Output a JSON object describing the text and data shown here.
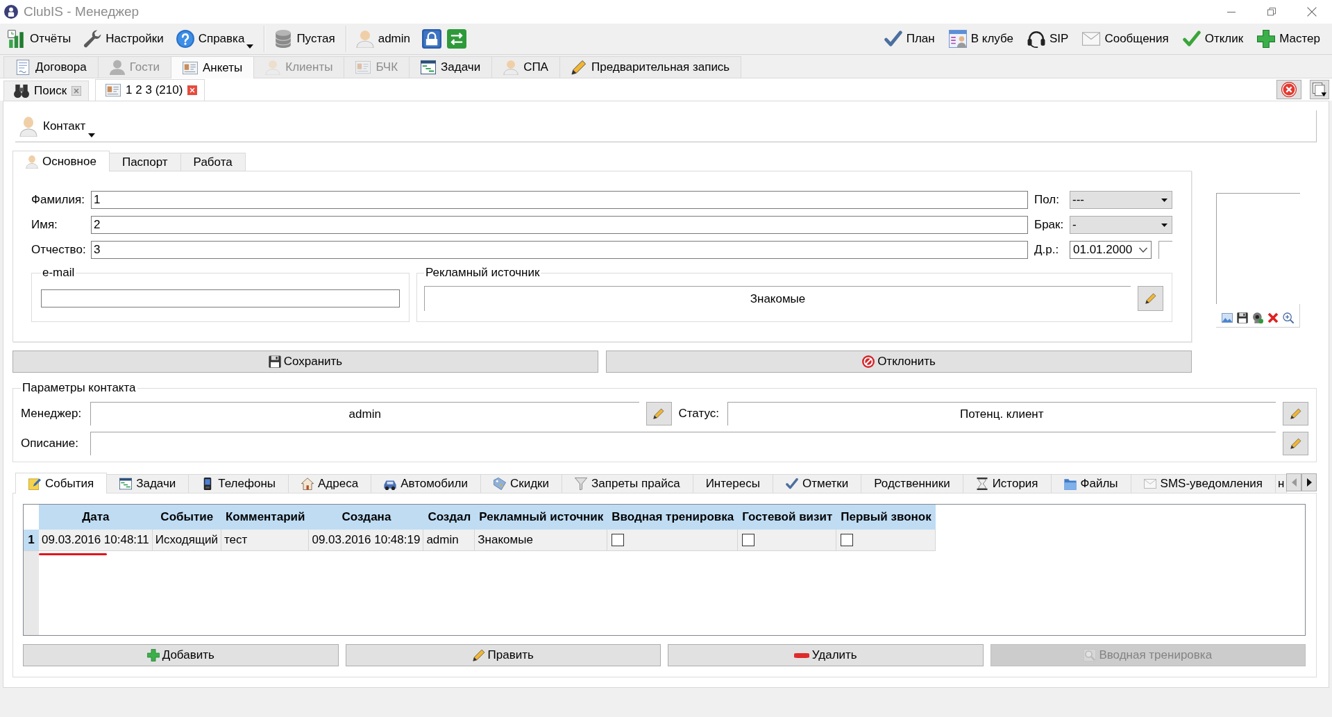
{
  "window": {
    "title": "ClubIS - Менеджер"
  },
  "toolbar": {
    "left_groups": [
      {
        "items": [
          {
            "label": "Отчёты",
            "dropdown": false
          },
          {
            "label": "Настройки",
            "dropdown": false
          },
          {
            "label": "Справка",
            "dropdown": true
          }
        ]
      },
      {
        "items": [
          {
            "label": "Пустая",
            "dropdown": false
          }
        ]
      },
      {
        "items": [
          {
            "label": "admin",
            "dropdown": false
          }
        ]
      }
    ],
    "right": [
      {
        "label": "План"
      },
      {
        "label": "В клубе"
      },
      {
        "label": "SIP"
      },
      {
        "label": "Сообщения"
      },
      {
        "label": "Отклик"
      },
      {
        "label": "Мастер"
      }
    ]
  },
  "module_tabs": [
    {
      "label": "Договора",
      "selected": false,
      "disabled": false
    },
    {
      "label": "Гости",
      "selected": false,
      "disabled": true
    },
    {
      "label": "Анкеты",
      "selected": true,
      "disabled": false
    },
    {
      "label": "Клиенты",
      "selected": false,
      "disabled": true
    },
    {
      "label": "БЧК",
      "selected": false,
      "disabled": true
    },
    {
      "label": "Задачи",
      "selected": false,
      "disabled": false
    },
    {
      "label": "СПА",
      "selected": false,
      "disabled": false
    },
    {
      "label": "Предварительная запись",
      "selected": false,
      "disabled": false
    }
  ],
  "document_tabs": [
    {
      "label": "Поиск",
      "selected": false
    },
    {
      "label": "1 2 3 (210)",
      "selected": true
    }
  ],
  "contact_menu": {
    "label": "Контакт"
  },
  "form_tabs": [
    {
      "label": "Основное",
      "selected": true
    },
    {
      "label": "Паспорт",
      "selected": false
    },
    {
      "label": "Работа",
      "selected": false
    }
  ],
  "form_rows": [
    {
      "label": "Фамилия:",
      "value": "1",
      "side": {
        "kind": "combo",
        "label": "Пол:",
        "value": "---"
      }
    },
    {
      "label": "Имя:",
      "value": "2",
      "side": {
        "kind": "combo",
        "label": "Брак:",
        "value": "-"
      }
    },
    {
      "label": "Отчество:",
      "value": "3",
      "side": {
        "kind": "date",
        "label": "Д.р.:",
        "value": "01.01.2000"
      }
    }
  ],
  "email_group": {
    "title": "e-mail"
  },
  "ad_source_group": {
    "title": "Рекламный источник",
    "value": "Знакомые"
  },
  "form_actions": [
    {
      "label": "Сохранить"
    },
    {
      "label": "Отклонить"
    }
  ],
  "contact_params": {
    "title": "Параметры контакта",
    "manager": {
      "label": "Менеджер:",
      "value": "admin"
    },
    "status": {
      "label": "Статус:",
      "value": "Потенц. клиент"
    },
    "description": {
      "label": "Описание:"
    }
  },
  "detail_tabs": [
    {
      "label": "События",
      "selected": true
    },
    {
      "label": "Задачи",
      "selected": false
    },
    {
      "label": "Телефоны",
      "selected": false
    },
    {
      "label": "Адреса",
      "selected": false
    },
    {
      "label": "Автомобили",
      "selected": false
    },
    {
      "label": "Скидки",
      "selected": false
    },
    {
      "label": "Запреты прайса",
      "selected": false
    },
    {
      "label": "Интересы",
      "selected": false
    },
    {
      "label": "Отметки",
      "selected": false
    },
    {
      "label": "Родственники",
      "selected": false
    },
    {
      "label": "История",
      "selected": false
    },
    {
      "label": "Файлы",
      "selected": false
    },
    {
      "label": "SMS-уведомления",
      "selected": false
    },
    {
      "label": "н",
      "selected": false
    }
  ],
  "tab_scroll": {
    "back_disabled": true,
    "forward_disabled": false
  },
  "events_table": {
    "columns": [
      "Дата",
      "Событие",
      "Комментарий",
      "Создана",
      "Создал",
      "Рекламный источник",
      "Вводная тренировка",
      "Гостевой визит",
      "Первый звонок"
    ],
    "rows": [
      {
        "number": "1",
        "cells": [
          "09.03.2016 10:48:11",
          "Исходящий",
          "тест",
          "09.03.2016 10:48:19",
          "admin",
          "Знакомые"
        ],
        "checks": [
          false,
          false,
          false
        ],
        "marked": true
      }
    ]
  },
  "table_buttons": [
    {
      "label": "Добавить",
      "disabled": false
    },
    {
      "label": "Править",
      "disabled": false
    },
    {
      "label": "Удалить",
      "disabled": false
    },
    {
      "label": "Вводная тренировка",
      "disabled": true
    }
  ]
}
